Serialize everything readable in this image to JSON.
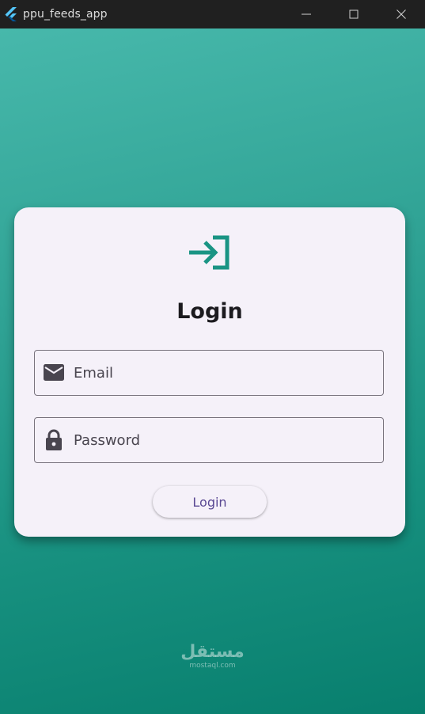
{
  "window": {
    "title": "ppu_feeds_app",
    "controls": {
      "minimize_icon": "minimize-icon",
      "maximize_icon": "maximize-icon",
      "close_icon": "close-icon"
    }
  },
  "login_card": {
    "icon": "login-icon",
    "title": "Login",
    "email": {
      "icon": "mail-icon",
      "placeholder": "Email",
      "value": ""
    },
    "password": {
      "icon": "lock-icon",
      "placeholder": "Password",
      "value": ""
    },
    "submit_label": "Login"
  },
  "watermark": {
    "arabic": "مستقل",
    "latin": "mostaql.com"
  },
  "colors": {
    "accent": "#1a9484",
    "background_top": "#47b8ab",
    "background_bottom": "#087f6e",
    "card": "#f5f1f9",
    "button_text": "#5b4a94"
  }
}
